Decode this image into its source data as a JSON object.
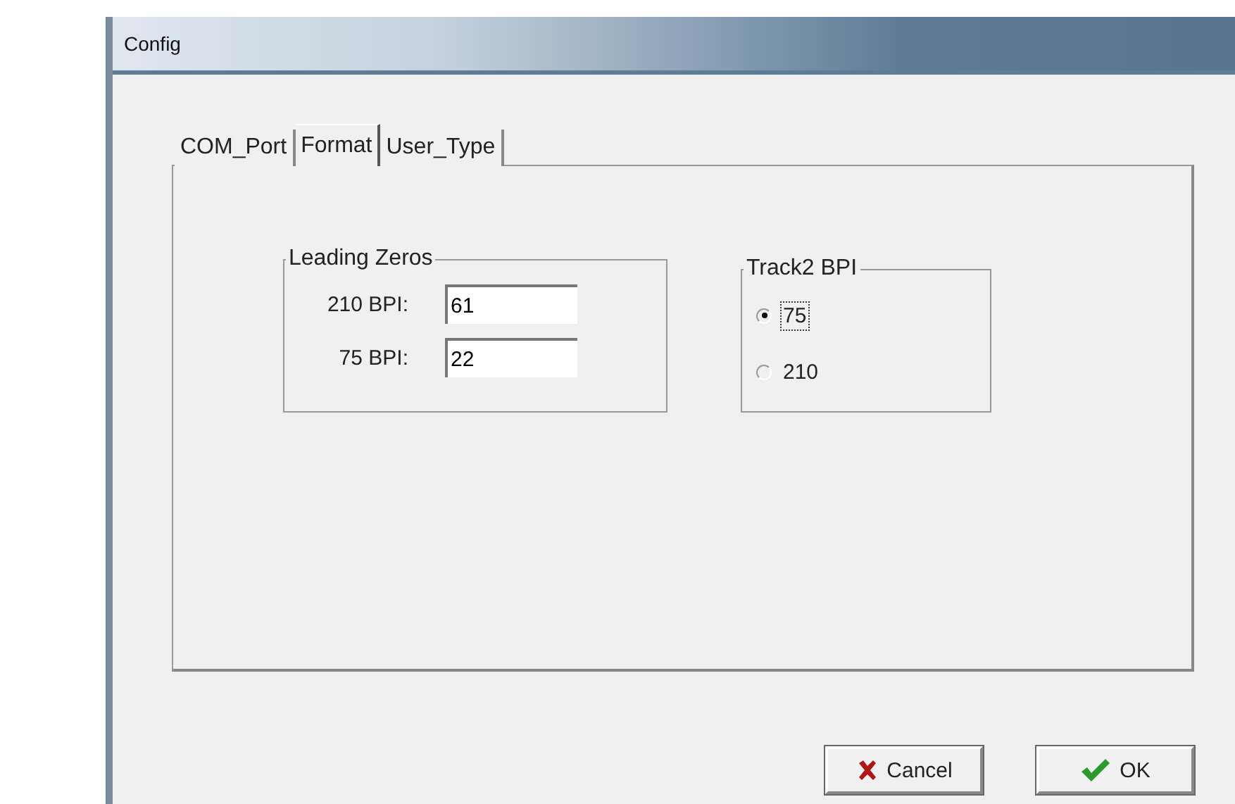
{
  "window": {
    "title": "Config"
  },
  "tabs": [
    {
      "label": "COM_Port",
      "selected": false
    },
    {
      "label": "Format",
      "selected": true
    },
    {
      "label": "User_Type",
      "selected": false
    }
  ],
  "leading_zeros": {
    "title": "Leading Zeros",
    "fields": [
      {
        "label": "210 BPI:",
        "value": "61"
      },
      {
        "label": "75 BPI:",
        "value": "22"
      }
    ]
  },
  "track2_bpi": {
    "title": "Track2 BPI",
    "options": [
      {
        "label": "75",
        "selected": true
      },
      {
        "label": "210",
        "selected": false
      }
    ]
  },
  "buttons": [
    {
      "kind": "cancel",
      "label": "Cancel"
    },
    {
      "kind": "ok",
      "label": "OK"
    }
  ]
}
